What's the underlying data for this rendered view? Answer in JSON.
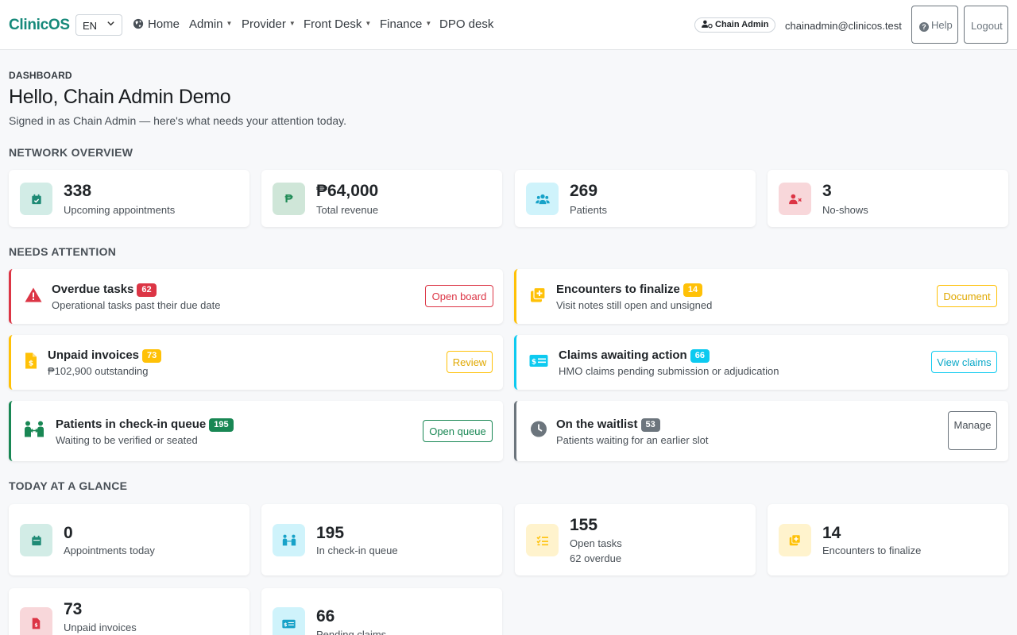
{
  "nav": {
    "brand": "ClinicOS",
    "language": "EN",
    "items": [
      {
        "label": "Home"
      },
      {
        "label": "Admin"
      },
      {
        "label": "Provider"
      },
      {
        "label": "Front Desk"
      },
      {
        "label": "Finance"
      },
      {
        "label": "DPO desk"
      }
    ],
    "role": "Chain Admin",
    "email": "chainadmin@clinicos.test",
    "help": "Help",
    "logout": "Logout"
  },
  "header": {
    "eyebrow": "DASHBOARD",
    "title": "Hello, Chain Admin Demo",
    "subtitle": "Signed in as Chain Admin — here's what needs your attention today."
  },
  "network": {
    "heading": "NETWORK OVERVIEW",
    "cards": [
      {
        "value": "338",
        "label": "Upcoming appointments",
        "icon": "calendar-check-icon",
        "color": "#1e8a75"
      },
      {
        "value": "₱64,000",
        "label": "Total revenue",
        "icon": "peso-icon",
        "color": "#1e8a55"
      },
      {
        "value": "269",
        "label": "Patients",
        "icon": "users-icon",
        "color": "#17a2c8"
      },
      {
        "value": "3",
        "label": "No-shows",
        "icon": "user-x-icon",
        "color": "#dc3545"
      }
    ]
  },
  "attention": {
    "heading": "NEEDS ATTENTION",
    "items": [
      {
        "title": "Overdue tasks",
        "badge": "62",
        "desc": "Operational tasks past their due date",
        "button": "Open board",
        "icon": "warning-icon",
        "color": "#dc3545"
      },
      {
        "title": "Encounters to finalize",
        "badge": "14",
        "desc": "Visit notes still open and unsigned",
        "button": "Document",
        "icon": "notes-plus-icon",
        "color": "#ffc107"
      },
      {
        "title": "Unpaid invoices",
        "badge": "73",
        "desc": "₱102,900 outstanding",
        "button": "Review",
        "icon": "invoice-icon",
        "color": "#ffc107"
      },
      {
        "title": "Claims awaiting action",
        "badge": "66",
        "desc": "HMO claims pending submission or adjudication",
        "button": "View claims",
        "icon": "claim-card-icon",
        "color": "#0dcaf0"
      },
      {
        "title": "Patients in check-in queue",
        "badge": "195",
        "desc": "Waiting to be verified or seated",
        "button": "Open queue",
        "icon": "people-queue-icon",
        "color": "#198754"
      },
      {
        "title": "On the waitlist",
        "badge": "53",
        "desc": "Patients waiting for an earlier slot",
        "button": "Manage",
        "icon": "clock-icon",
        "color": "#6c757d"
      }
    ]
  },
  "today": {
    "heading": "TODAY AT A GLANCE",
    "cards": [
      {
        "value": "0",
        "label": "Appointments today",
        "icon": "calendar-icon"
      },
      {
        "value": "195",
        "label": "In check-in queue",
        "icon": "people-queue-icon"
      },
      {
        "value": "155",
        "label": "Open tasks",
        "sub": "62 overdue",
        "icon": "checklist-icon"
      },
      {
        "value": "14",
        "label": "Encounters to finalize",
        "icon": "notes-plus-icon"
      },
      {
        "value": "73",
        "label": "Unpaid invoices",
        "icon": "invoice-icon"
      },
      {
        "value": "66",
        "label": "Pending claims",
        "icon": "claim-card-icon"
      }
    ]
  }
}
